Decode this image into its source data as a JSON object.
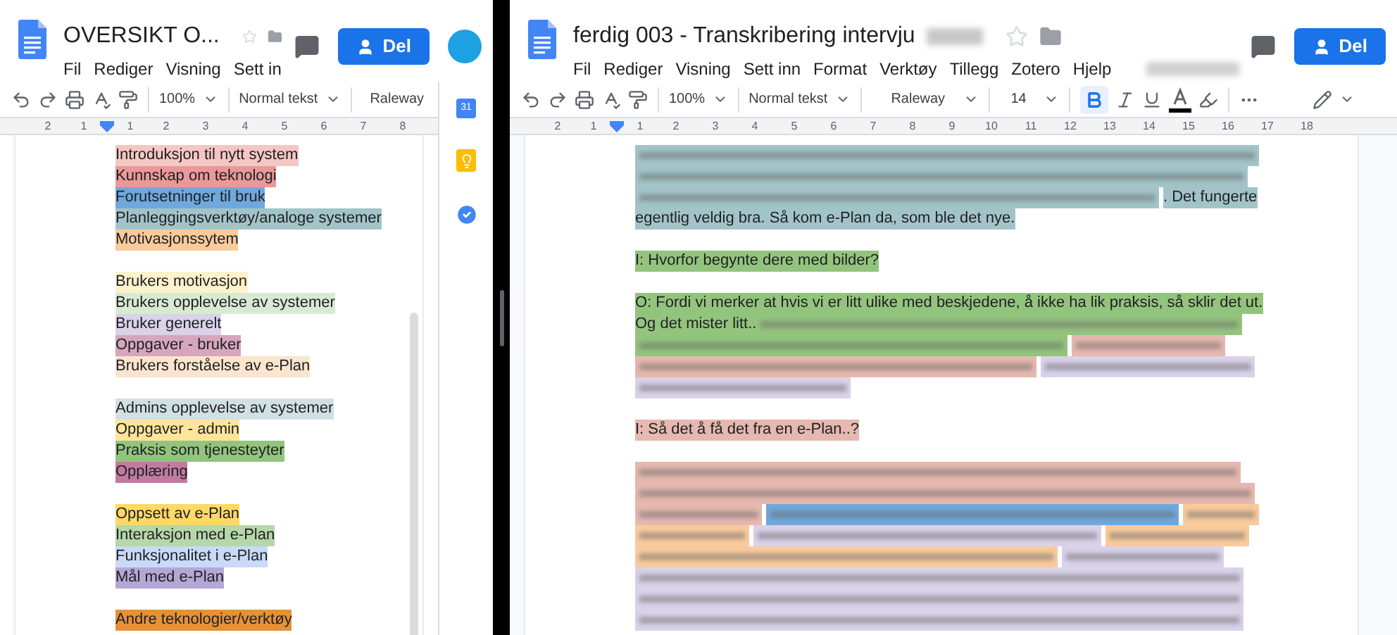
{
  "left_doc": {
    "title": "OVERSIKT O...",
    "menu": [
      "Fil",
      "Rediger",
      "Visning",
      "Sett in"
    ],
    "share_button": "Del",
    "toolbar": {
      "zoom": "100%",
      "style": "Normal tekst",
      "font": "Raleway"
    },
    "ruler": [
      "2",
      "1",
      "1",
      "2",
      "3",
      "4",
      "5",
      "6",
      "7",
      "8"
    ],
    "side_panel": {
      "calendar_day": "31"
    },
    "code_groups": [
      [
        {
          "label": "Introduksjon til nytt system",
          "color": "#f4c7c3"
        },
        {
          "label": "Kunnskap om teknologi",
          "color": "#ea9999"
        },
        {
          "label": "Forutsetninger til bruk",
          "color": "#6fa8dc"
        },
        {
          "label": "Planleggingsverktøy/analoge systemer",
          "color": "#a2c4c9"
        },
        {
          "label": "Motivasjonssytem",
          "color": "#f9cb9c"
        }
      ],
      [
        {
          "label": "Brukers motivasjon",
          "color": "#fff2cc"
        },
        {
          "label": "Brukers opplevelse av systemer",
          "color": "#d9ead3"
        },
        {
          "label": "Bruker generelt",
          "color": "#d9d2e9"
        },
        {
          "label": "Oppgaver - bruker",
          "color": "#d5a6bd"
        },
        {
          "label": "Brukers forståelse av e-Plan",
          "color": "#fce5cd"
        }
      ],
      [
        {
          "label": "Admins opplevelse av systemer",
          "color": "#d0e0e3"
        },
        {
          "label": "Oppgaver - admin",
          "color": "#ffe599"
        },
        {
          "label": "Praksis som tjenesteyter",
          "color": "#93c47d"
        },
        {
          "label": "Opplæring",
          "color": "#c27ba0"
        }
      ],
      [
        {
          "label": "Oppsett av e-Plan",
          "color": "#ffd966"
        },
        {
          "label": "Interaksjon med e-Plan",
          "color": "#b6d7a8"
        },
        {
          "label": "Funksjonalitet i e-Plan",
          "color": "#c9daf8"
        },
        {
          "label": "Mål med e-Plan",
          "color": "#b4a7d6"
        }
      ],
      [
        {
          "label": "Andre teknologier/verktøy",
          "color": "#e69138"
        }
      ]
    ]
  },
  "right_doc": {
    "title": "ferdig 003 - Transkribering intervju",
    "menu": [
      "Fil",
      "Rediger",
      "Visning",
      "Sett inn",
      "Format",
      "Verktøy",
      "Tillegg",
      "Zotero",
      "Hjelp"
    ],
    "share_button": "Del",
    "toolbar": {
      "zoom": "100%",
      "style": "Normal tekst",
      "font": "Raleway",
      "font_size": "14"
    },
    "ruler": [
      "2",
      "1",
      "1",
      "2",
      "3",
      "4",
      "5",
      "6",
      "7",
      "8",
      "9",
      "10",
      "11",
      "12",
      "13",
      "14",
      "15",
      "16",
      "17",
      "18"
    ],
    "paragraphs": [
      [
        [
          {
            "kind": "redacted",
            "color": "#a2c4c9"
          }
        ],
        [
          {
            "kind": "redacted",
            "color": "#a2c4c9"
          }
        ],
        [
          {
            "kind": "redacted",
            "color": "#a2c4c9"
          },
          {
            "kind": "text",
            "text": ". Det fungerte",
            "color": "#a2c4c9"
          }
        ],
        [
          {
            "kind": "text",
            "text": "egentlig veldig bra. Så kom e-Plan da, som ble det nye.",
            "color": "#a2c4c9"
          }
        ]
      ],
      [
        [
          {
            "kind": "text",
            "text": "I: Hvorfor begynte dere med bilder?",
            "color": "#93c47d"
          }
        ]
      ],
      [
        [
          {
            "kind": "text",
            "text": "O: Fordi vi merker at hvis vi er litt ulike med beskjedene, å ikke ha lik praksis, så sklir det ut.",
            "color": "#93c47d"
          }
        ],
        [
          {
            "kind": "text",
            "text": "Og det mister litt..",
            "color": "#93c47d"
          },
          {
            "kind": "redacted",
            "color": "#93c47d"
          }
        ],
        [
          {
            "kind": "redacted",
            "color": "#93c47d"
          },
          {
            "kind": "redacted",
            "color": "#e6b8af"
          }
        ],
        [
          {
            "kind": "redacted",
            "color": "#e6b8af"
          },
          {
            "kind": "redacted",
            "color": "#d9d2e9"
          }
        ],
        [
          {
            "kind": "redacted",
            "color": "#d9d2e9"
          }
        ]
      ],
      [
        [
          {
            "kind": "text",
            "text": "I: Så det å få det fra en e-Plan..?",
            "color": "#e6b8af"
          }
        ]
      ],
      [
        [
          {
            "kind": "redacted",
            "color": "#e6b8af"
          }
        ],
        [
          {
            "kind": "redacted",
            "color": "#e6b8af"
          }
        ],
        [
          {
            "kind": "redacted",
            "color": "#e6b8af"
          },
          {
            "kind": "redacted",
            "color": "#6fa8dc"
          },
          {
            "kind": "redacted",
            "color": "#f9cb9c"
          }
        ],
        [
          {
            "kind": "redacted",
            "color": "#f9cb9c"
          },
          {
            "kind": "redacted",
            "color": "#d9d2e9"
          },
          {
            "kind": "redacted",
            "color": "#f9cb9c"
          }
        ],
        [
          {
            "kind": "redacted",
            "color": "#f9cb9c"
          },
          {
            "kind": "redacted",
            "color": "#d9d2e9"
          }
        ],
        [
          {
            "kind": "redacted",
            "color": "#d9d2e9"
          }
        ],
        [
          {
            "kind": "redacted",
            "color": "#d9d2e9"
          }
        ],
        [
          {
            "kind": "redacted",
            "color": "#d9d2e9"
          }
        ]
      ]
    ]
  }
}
